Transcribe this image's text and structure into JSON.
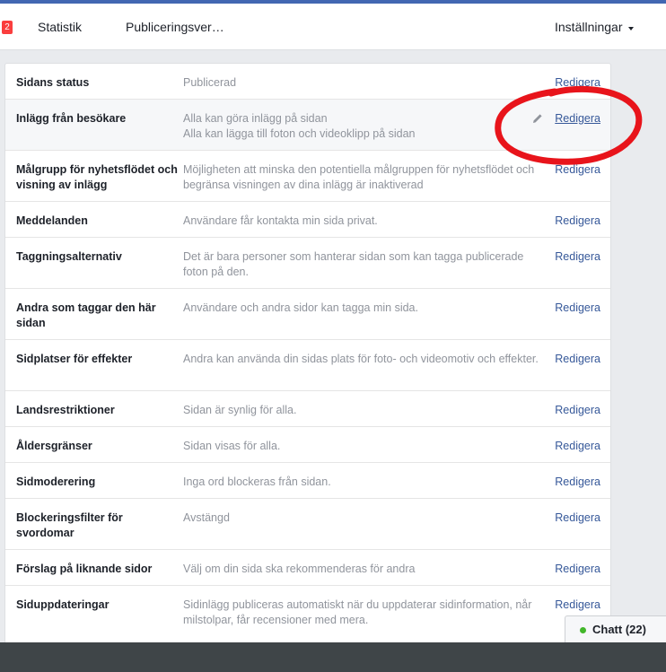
{
  "header": {
    "badge_count": "2",
    "tabs": [
      "Statistik",
      "Publiceringsver…"
    ],
    "settings_label": "Inställningar"
  },
  "settings": {
    "edit_label": "Redigera",
    "rows": [
      {
        "label": "Sidans status",
        "value": "Publicerad"
      },
      {
        "label": "Inlägg från besökare",
        "value": "Alla kan göra inlägg på sidan\nAlla kan lägga till foton och videoklipp på sidan"
      },
      {
        "label": "Målgrupp för nyhetsflödet och visning av inlägg",
        "value": "Möjligheten att minska den potentiella målgruppen för nyhetsflödet och begränsa visningen av dina inlägg är inaktiverad"
      },
      {
        "label": "Meddelanden",
        "value": "Användare får kontakta min sida privat."
      },
      {
        "label": "Taggningsalternativ",
        "value": "Det är bara personer som hanterar sidan som kan tagga publicerade foton på den."
      },
      {
        "label": "Andra som taggar den här sidan",
        "value": "Användare och andra sidor kan tagga min sida."
      },
      {
        "label": "Sidplatser för effekter",
        "value": "Andra kan använda din sidas plats för foto- och videomotiv och effekter."
      },
      {
        "label": "Landsrestriktioner",
        "value": "Sidan är synlig för alla."
      },
      {
        "label": "Åldersgränser",
        "value": "Sidan visas för alla."
      },
      {
        "label": "Sidmoderering",
        "value": "Inga ord blockeras från sidan."
      },
      {
        "label": "Blockeringsfilter för svordomar",
        "value": "Avstängd"
      },
      {
        "label": "Förslag på liknande sidor",
        "value": "Välj om din sida ska rekommenderas för andra"
      },
      {
        "label": "Siduppdateringar",
        "value": "Sidinlägg publiceras automatiskt när du uppdaterar sidinformation, når milstolpar, får recensioner med mera."
      }
    ]
  },
  "chat": {
    "label": "Chatt (22)"
  },
  "colors": {
    "brand": "#4267b2",
    "link": "#365899",
    "annotation": "#e8141b",
    "online": "#42b72a"
  },
  "icons": [
    "pencil-icon",
    "caret-down-icon",
    "online-dot-icon"
  ]
}
